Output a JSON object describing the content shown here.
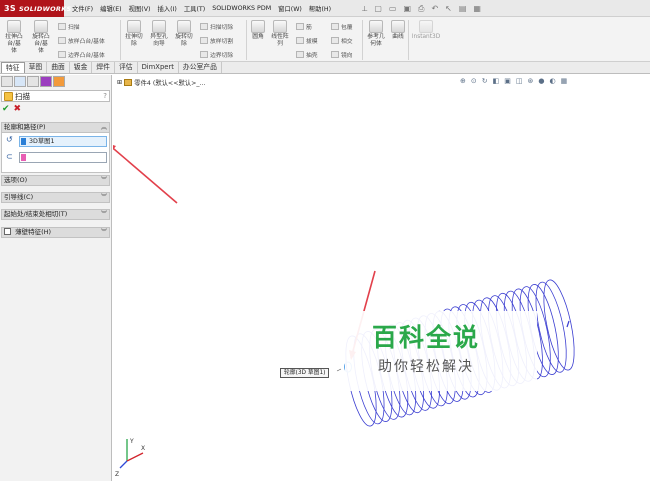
{
  "app": {
    "logo_text": "SOLIDWORKS",
    "logo_mark": "3S"
  },
  "menu": [
    "文件(F)",
    "编辑(E)",
    "视图(V)",
    "插入(I)",
    "工具(T)",
    "SOLIDWORKS PDM",
    "窗口(W)",
    "帮助(H)"
  ],
  "ribbon": {
    "extrude_boss": "拉伸凸\n台/基\n体",
    "revolve_boss": "旋转凸\n台/基\n体",
    "sweep": "扫描",
    "loft": "放样凸台/基体",
    "boundary": "边界凸台/基体",
    "extrude_cut": "拉伸切\n除",
    "hole_wizard": "异型孔\n向导",
    "revolve_cut": "旋转切\n除",
    "swept_cut": "扫描切除",
    "lofted_cut": "放样切割",
    "boundary_cut": "边界切除",
    "fillet": "圆角",
    "linear_pattern": "线性阵\n列",
    "rib": "筋",
    "draft": "拔模",
    "shell": "抽壳",
    "wrap": "包覆",
    "intersect": "相交",
    "mirror": "镜向",
    "ref_geometry": "参考几\n何体",
    "curves": "曲线",
    "instant3d": "Instant3D"
  },
  "tabs": [
    {
      "label": "特征",
      "active": true
    },
    {
      "label": "草图",
      "active": false
    },
    {
      "label": "曲面",
      "active": false
    },
    {
      "label": "钣金",
      "active": false
    },
    {
      "label": "焊件",
      "active": false
    },
    {
      "label": "评估",
      "active": false
    },
    {
      "label": "DimXpert",
      "active": false
    },
    {
      "label": "办公室产品",
      "active": false
    }
  ],
  "property_manager": {
    "title": "扫描",
    "help": "?",
    "groups": {
      "profile_path": "轮廓和路径(P)",
      "options": "选项(O)",
      "guide_curves": "引导线(C)",
      "start_end": "起始处/结束处相切(T)",
      "thin_feature": "薄壁特征(H)"
    },
    "selection_1": "3D草图1",
    "selection_2": ""
  },
  "viewport": {
    "tree_item": "零件4 (默认<<默认>_...",
    "callout": "轮廓(3D 草图1)"
  },
  "watermark": {
    "title": "百科全说",
    "subtitle": "助你轻松解决"
  },
  "colors": {
    "brand": "#b0141a",
    "helix": "#3b3ed1",
    "arrow": "#e2404b",
    "watermark": "#2aa84a"
  }
}
